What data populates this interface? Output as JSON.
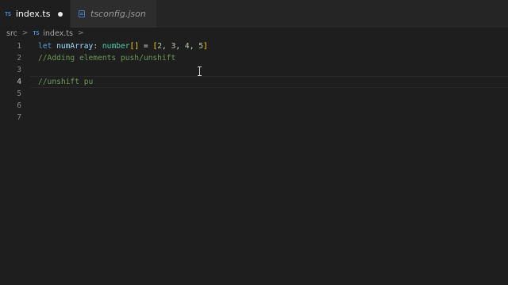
{
  "tabs": [
    {
      "label": "index.ts",
      "badge": "TS",
      "active": true,
      "modified": true
    },
    {
      "label": "tsconfig.json",
      "active": false
    }
  ],
  "breadcrumb": {
    "folder": "src",
    "separator": ">",
    "badge": "TS",
    "file": "index.ts"
  },
  "editor": {
    "current_line": 4,
    "lines": [
      {
        "number": "1",
        "tokens": [
          "let",
          " ",
          "numArray",
          ": ",
          "number",
          "[]",
          " = ",
          "[",
          "2",
          ", ",
          "3",
          ", ",
          "4",
          ", ",
          "5",
          "]"
        ]
      },
      {
        "number": "2",
        "text": "//Adding elements push/unshift"
      },
      {
        "number": "3",
        "text": ""
      },
      {
        "number": "4",
        "text": "//unshift pu"
      },
      {
        "number": "5",
        "text": ""
      },
      {
        "number": "6",
        "text": ""
      },
      {
        "number": "7",
        "text": ""
      }
    ]
  },
  "colors": {
    "background": "#1e1e1e",
    "keyword": "#569cd6",
    "variable": "#9cdcfe",
    "type": "#4ec9b0",
    "bracket": "#ffd700",
    "number": "#b5cea8",
    "comment": "#6a9955"
  },
  "icons": {
    "ts_file": "typescript-file-icon",
    "json_file": "json-file-icon",
    "cursor": "text-cursor-icon"
  }
}
